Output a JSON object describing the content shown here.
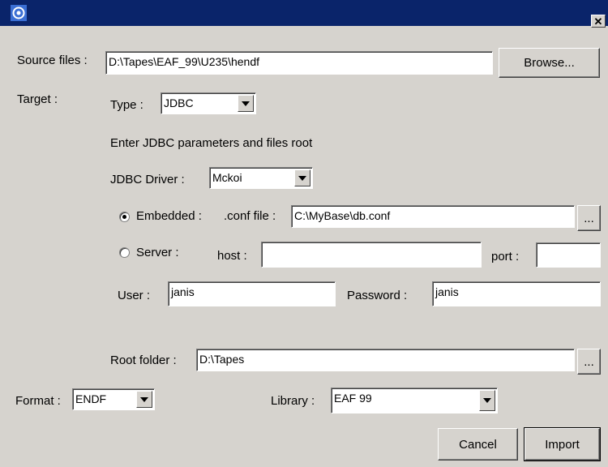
{
  "window": {
    "title": "",
    "close_glyph": "✕"
  },
  "source": {
    "label": "Source files :",
    "value": "D:\\Tapes\\EAF_99\\U235\\hendf",
    "browse": "Browse..."
  },
  "target": {
    "label": "Target :"
  },
  "type_field": {
    "label": "Type :",
    "value": "JDBC"
  },
  "jdbc": {
    "hint": "Enter JDBC parameters and files root",
    "driver_label": "JDBC Driver :",
    "driver_value": "Mckoi"
  },
  "embedded": {
    "label": "Embedded :",
    "conf_label": ".conf file :",
    "value": "C:\\MyBase\\db.conf",
    "selected": true,
    "more": "..."
  },
  "server": {
    "label": "Server :",
    "host_label": "host :",
    "host_value": "",
    "port_label": "port :",
    "port_value": "",
    "selected": false
  },
  "user": {
    "label": "User :",
    "value": "janis"
  },
  "password": {
    "label": "Password :",
    "value": "janis"
  },
  "root": {
    "label": "Root folder :",
    "value": "D:\\Tapes",
    "more": "..."
  },
  "format": {
    "label": "Format :",
    "value": "ENDF"
  },
  "library": {
    "label": "Library :",
    "value": "EAF 99"
  },
  "buttons": {
    "cancel": "Cancel",
    "import": "Import"
  },
  "colors": {
    "titlebar": "#0a246a",
    "dialog": "#d6d3ce"
  }
}
